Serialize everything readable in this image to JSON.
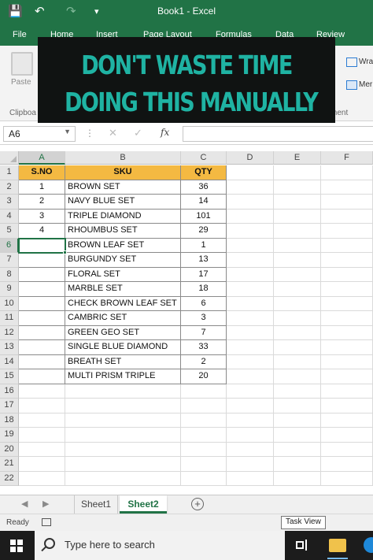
{
  "window": {
    "title": "Book1  -  Excel",
    "save_icon": "💾",
    "undo_icon": "↶",
    "redo_icon": "↷",
    "customize_icon": "▾"
  },
  "ribbon_tabs": [
    "File",
    "Home",
    "Insert",
    "Page Layout",
    "Formulas",
    "Data",
    "Review"
  ],
  "ribbon": {
    "paste_label": "Paste",
    "clipboard_label": "Clipboa",
    "wrap_label": "Wra",
    "merge_label": "Mer",
    "alignment_label": "ment"
  },
  "banner": {
    "line1": "DON'T WASTE TIME",
    "line2": "DOING THIS MANUALLY",
    "text_color": "#1fb3a3",
    "bg_color": "#101312"
  },
  "formula_bar": {
    "name_box": "A6",
    "fx_label": "fx",
    "formula": ""
  },
  "grid": {
    "columns": [
      "A",
      "B",
      "C",
      "D",
      "E",
      "F"
    ],
    "row_numbers": [
      "1",
      "2",
      "3",
      "4",
      "5",
      "6",
      "7",
      "8",
      "9",
      "10",
      "11",
      "12",
      "13",
      "14",
      "15",
      "16",
      "17",
      "18",
      "19",
      "20",
      "21",
      "22"
    ],
    "header_row": [
      "S.NO",
      "SKU",
      "QTY"
    ],
    "header_color": "#f4b942",
    "rows": [
      [
        "1",
        "BROWN SET",
        "36"
      ],
      [
        "2",
        "NAVY BLUE SET",
        "14"
      ],
      [
        "3",
        "TRIPLE DIAMOND",
        "101"
      ],
      [
        "4",
        "RHOUMBUS SET",
        "29"
      ],
      [
        "",
        "BROWN LEAF SET",
        "1"
      ],
      [
        "",
        "BURGUNDY SET",
        "13"
      ],
      [
        "",
        "FLORAL SET",
        "17"
      ],
      [
        "",
        "MARBLE SET",
        "18"
      ],
      [
        "",
        "CHECK BROWN LEAF SET",
        "6"
      ],
      [
        "",
        "CAMBRIC SET",
        "3"
      ],
      [
        "",
        "GREEN GEO SET",
        "7"
      ],
      [
        "",
        "SINGLE BLUE DIAMOND",
        "33"
      ],
      [
        "",
        "BREATH SET",
        "2"
      ],
      [
        "",
        "MULTI PRISM TRIPLE",
        "20"
      ]
    ],
    "selected_cell": "A6"
  },
  "sheets": {
    "tabs": [
      "Sheet1",
      "Sheet2"
    ],
    "active": "Sheet2",
    "add_label": "+"
  },
  "status": {
    "text": "Ready",
    "tooltip": "Task View"
  },
  "taskbar": {
    "search_placeholder": "Type here to search"
  },
  "colors": {
    "excel_green": "#217346",
    "taskbar": "#1c1c1c"
  }
}
